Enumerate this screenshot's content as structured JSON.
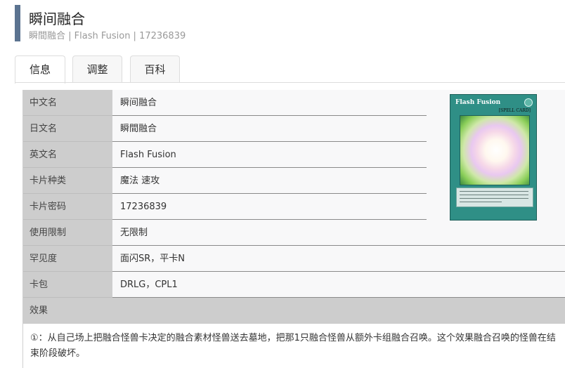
{
  "header": {
    "title": "瞬间融合",
    "subtitle": "瞬間融合 | Flash Fusion | 17236839"
  },
  "tabs": [
    {
      "label": "信息",
      "active": true
    },
    {
      "label": "调整",
      "active": false
    },
    {
      "label": "百科",
      "active": false
    }
  ],
  "info": {
    "rows": [
      {
        "label": "中文名",
        "value": "瞬间融合"
      },
      {
        "label": "日文名",
        "value": "瞬間融合"
      },
      {
        "label": "英文名",
        "value": "Flash Fusion"
      },
      {
        "label": "卡片种类",
        "value": "魔法 速攻"
      },
      {
        "label": "卡片密码",
        "value": "17236839"
      },
      {
        "label": "使用限制",
        "value": "无限制"
      },
      {
        "label": "罕见度",
        "value": "面闪SR，平卡N"
      },
      {
        "label": "卡包",
        "value": "DRLG，CPL1"
      }
    ],
    "effect_label": "效果",
    "effect_text": "①：从自己场上把融合怪兽卡决定的融合素材怪兽送去墓地，把那1只融合怪兽从额外卡组融合召唤。这个效果融合召唤的怪兽在结束阶段破坏。"
  },
  "card_image": {
    "name": "Flash Fusion",
    "type_line": "[SPELL CARD]"
  },
  "colors": {
    "accent_bar": "#5b7390",
    "label_bg": "#cdcdcd",
    "card_frame": "#2f8f86"
  }
}
